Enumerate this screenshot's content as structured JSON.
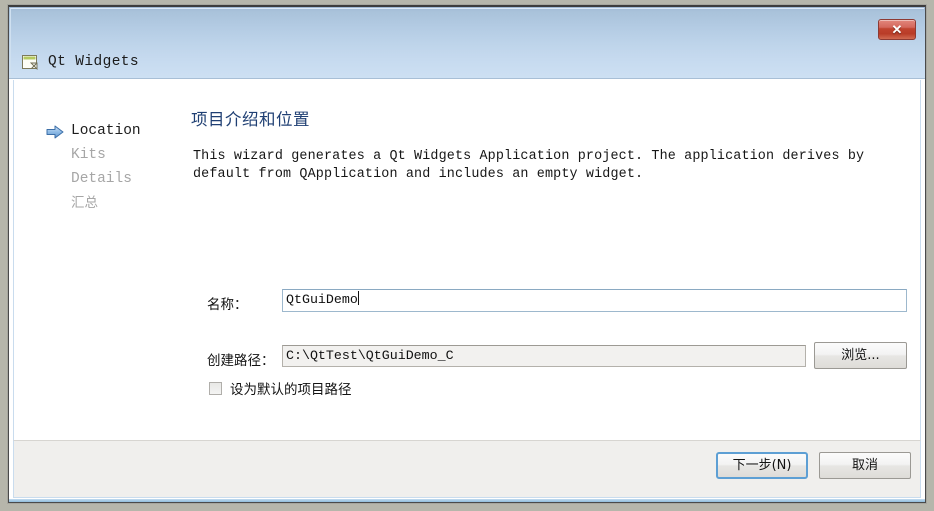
{
  "window": {
    "title": "Qt Widgets",
    "icon": "window-document-icon",
    "close_label": "✕",
    "accent_blue": "#1f3f73",
    "close_red": "#c0432f"
  },
  "nav": {
    "items": [
      {
        "label": "Location",
        "state": "active",
        "script": "latin"
      },
      {
        "label": "Kits",
        "state": "inactive",
        "script": "latin"
      },
      {
        "label": "Details",
        "state": "inactive",
        "script": "latin"
      },
      {
        "label": "汇总",
        "state": "inactive",
        "script": "cjk"
      }
    ]
  },
  "page": {
    "heading": "项目介绍和位置",
    "description": "This wizard generates a Qt Widgets Application project. The application derives by default from QApplication and includes an empty widget."
  },
  "form": {
    "name": {
      "label": "名称：",
      "value": "QtGuiDemo",
      "placeholder": ""
    },
    "path": {
      "label": "创建路径：",
      "value": "C:\\QtTest\\QtGuiDemo_C",
      "placeholder": ""
    },
    "browse_label": "浏览...",
    "default_path_checkbox": {
      "label": "设为默认的项目路径",
      "checked": false
    }
  },
  "footer": {
    "next_label": "下一步(N)",
    "cancel_label": "取消"
  }
}
